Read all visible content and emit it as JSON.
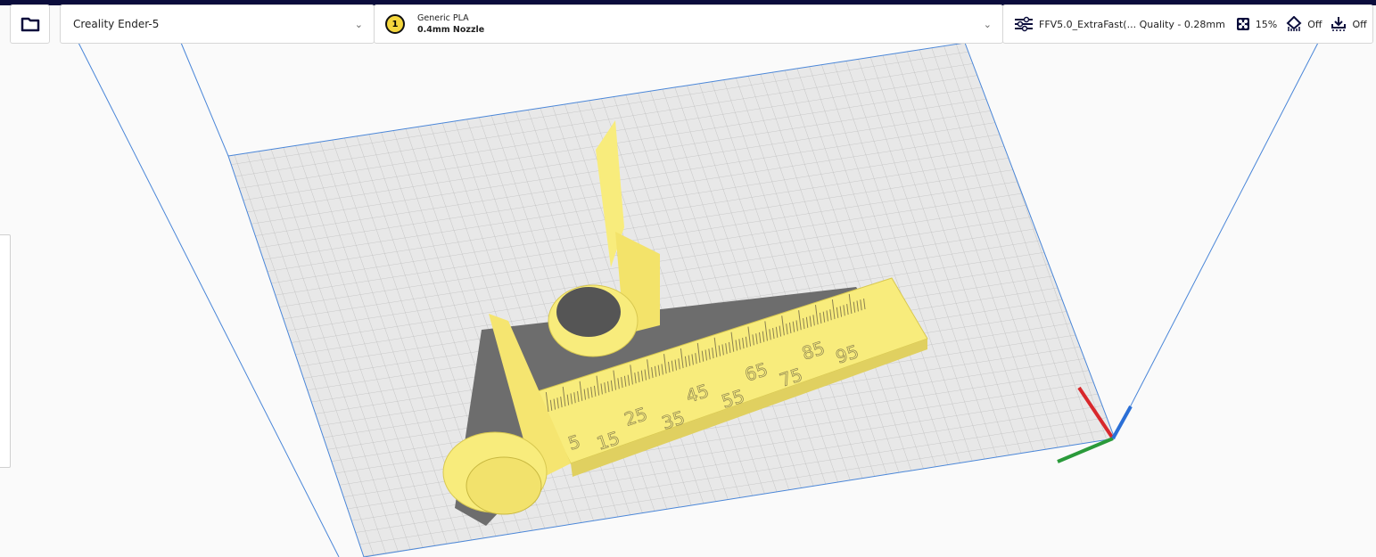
{
  "toolbar": {
    "open_icon": "folder-icon",
    "machine": "Creality Ender-5",
    "material_name": "Generic PLA",
    "nozzle": "0.4mm Nozzle",
    "extruder_number": "1",
    "profile": "FFV5.0_ExtraFast(... Quality - 0.28mm",
    "infill": "15%",
    "support": "Off",
    "adhesion": "Off"
  },
  "model": {
    "ruler_labels": [
      "5",
      "15",
      "25",
      "35",
      "45",
      "55",
      "65",
      "75",
      "85",
      "95"
    ]
  },
  "colors": {
    "header": "#0b0d3c",
    "plate": "#e6e6e6",
    "model": "#f8ec7c",
    "shadow": "#6d6d6d",
    "axis_x": "#d8282c",
    "axis_y": "#2a9a3a",
    "axis_z": "#2b6fd6"
  }
}
